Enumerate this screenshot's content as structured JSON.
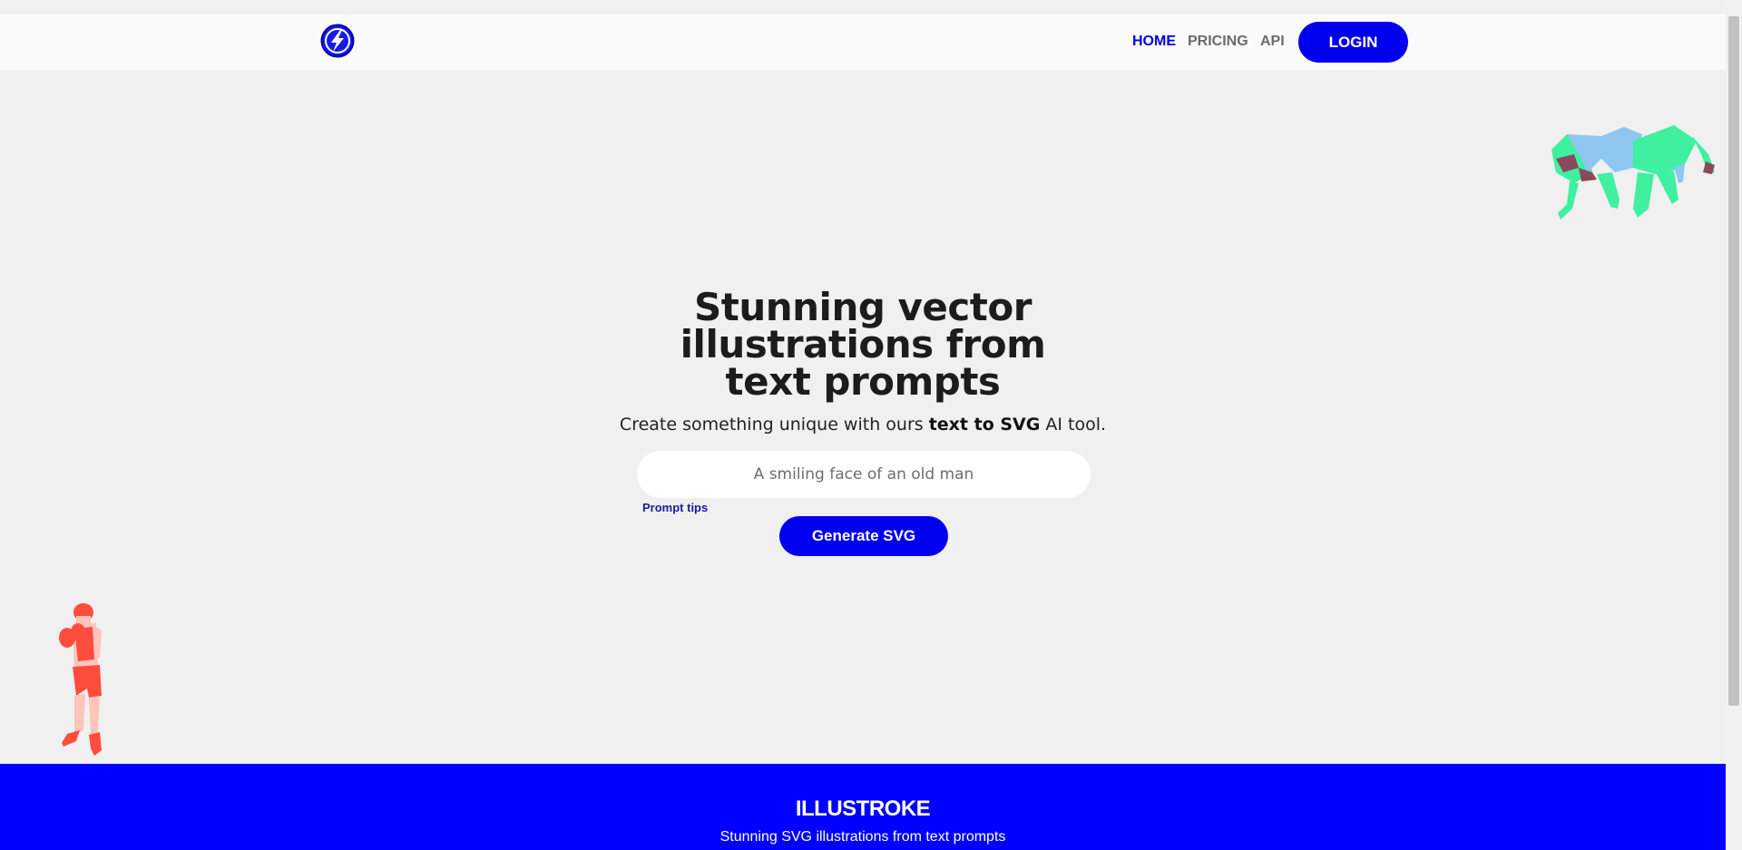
{
  "nav": {
    "logo_icon": "lightning-bolt-logo-icon",
    "links": [
      "HOME",
      "PRICING",
      "API"
    ],
    "login_label": "LOGIN"
  },
  "hero": {
    "title": "Stunning vector illustrations from text prompts",
    "subtitle_pre": "Create something unique with ours ",
    "subtitle_bold": "text to SVG",
    "subtitle_post": " AI tool.",
    "prompt_placeholder": "A smiling face of an old man",
    "prompt_tips_label": "Prompt tips",
    "generate_label": "Generate SVG"
  },
  "footer": {
    "brand": "ILLUSTROKE",
    "tagline": "Stunning SVG illustrations from text prompts"
  },
  "colors": {
    "accent": "#0000ee",
    "footer_bg": "#0000ff",
    "page_bg": "#f0f0f0"
  }
}
